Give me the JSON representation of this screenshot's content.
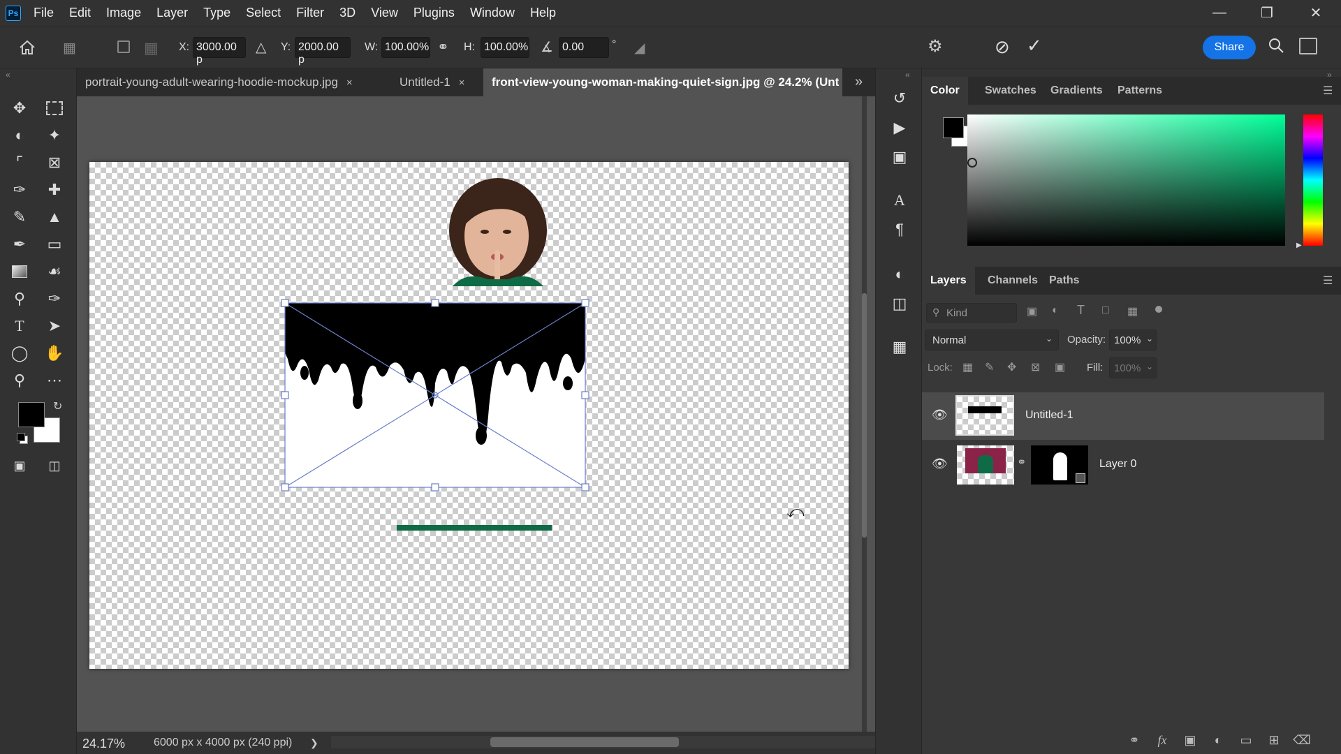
{
  "menubar": {
    "logo": "Ps",
    "items": [
      "File",
      "Edit",
      "Image",
      "Layer",
      "Type",
      "Select",
      "Filter",
      "3D",
      "View",
      "Plugins",
      "Window",
      "Help"
    ]
  },
  "options": {
    "x_label": "X:",
    "x_value": "3000.00 p",
    "y_label": "Y:",
    "y_value": "2000.00 p",
    "w_label": "W:",
    "w_value": "100.00%",
    "h_label": "H:",
    "h_value": "100.00%",
    "angle_value": "0.00",
    "degree_symbol": "°",
    "share_label": "Share"
  },
  "tabs": [
    {
      "label": "portrait-young-adult-wearing-hoodie-mockup.jpg",
      "close": "×"
    },
    {
      "label": "Untitled-1",
      "close": "×"
    },
    {
      "label": "front-view-young-woman-making-quiet-sign.jpg @ 24.2% (Unt"
    }
  ],
  "status": {
    "zoom": "24.17%",
    "doc_info": "6000 px x 4000 px (240 ppi)",
    "arrow": "❯"
  },
  "color_panel": {
    "tabs": [
      "Color",
      "Swatches",
      "Gradients",
      "Patterns"
    ],
    "foreground": "#000000",
    "background": "#ffffff",
    "hue_color": "#00ff99"
  },
  "layers_panel": {
    "tabs": [
      "Layers",
      "Channels",
      "Paths"
    ],
    "kind_placeholder": "Kind",
    "blend_mode": "Normal",
    "opacity_label": "Opacity:",
    "opacity_value": "100%",
    "lock_label": "Lock:",
    "fill_label": "Fill:",
    "fill_value": "100%",
    "layers": [
      {
        "name": "Untitled-1",
        "visible": true,
        "selected": true
      },
      {
        "name": "Layer 0",
        "visible": true,
        "selected": false
      }
    ]
  }
}
